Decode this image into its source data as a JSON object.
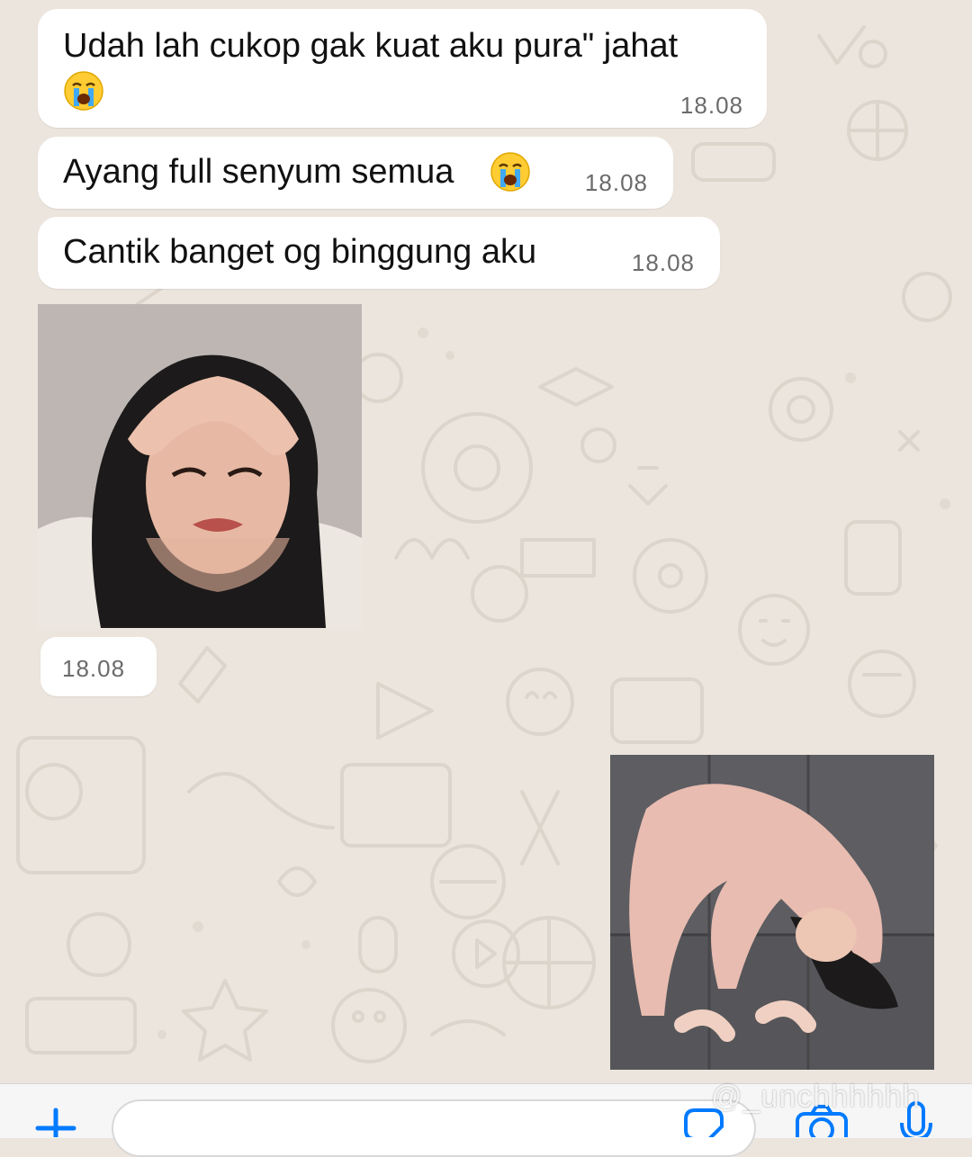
{
  "chat": {
    "messages": [
      {
        "text": "Udah lah cukop gak kuat aku pura\" jahat",
        "time": "18.08",
        "emoji": "loudly-crying-face"
      },
      {
        "text": "Ayang full senyum semua",
        "time": "18.08",
        "emoji": "loudly-crying-face"
      },
      {
        "text": "Cantik banget og binggung aku",
        "time": "18.08"
      }
    ],
    "sticker_time": "18.08"
  },
  "composer": {
    "add_icon": "plus-icon",
    "sticker_icon": "sticker-icon",
    "camera_icon": "camera-icon",
    "mic_icon": "microphone-icon"
  },
  "overlay": {
    "watermark": "@_unchhhhhh"
  },
  "colors": {
    "wallpaper": "#ece5dd",
    "bubble": "#ffffff",
    "accent": "#007aff",
    "time": "#6b6b6b"
  }
}
